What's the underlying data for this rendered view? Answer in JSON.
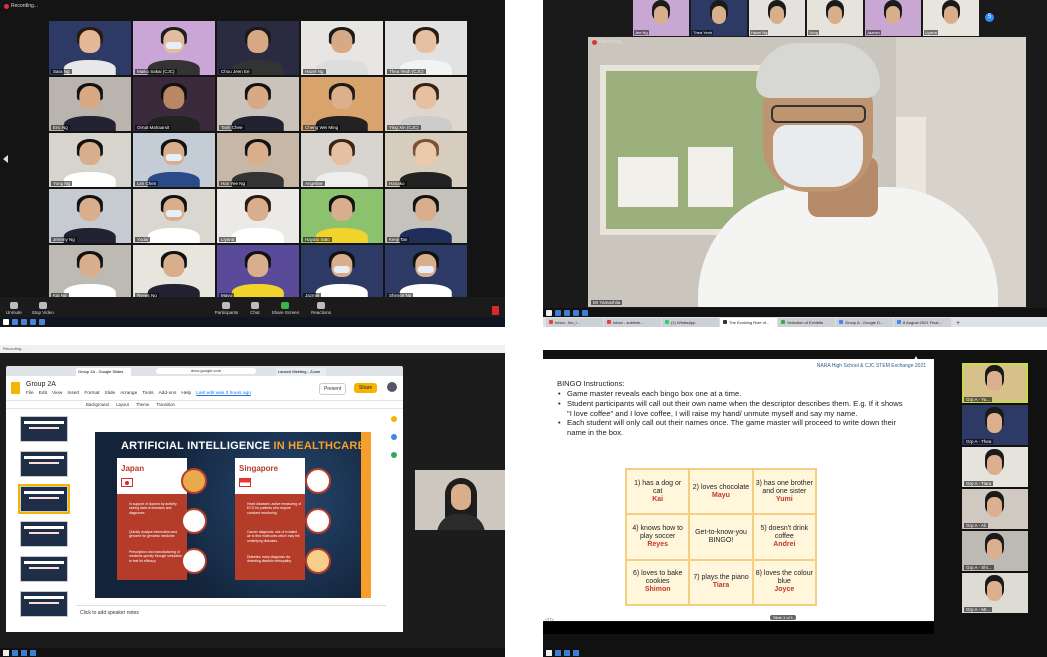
{
  "recording_label": "Recording...",
  "gallery": {
    "tiles": [
      {
        "name": "Sara Ng",
        "bg": "#2d3a66",
        "skin": "#e4b894",
        "hair": "#2a1a12",
        "body": "#e8e8e8",
        "mask": false,
        "speaker": true
      },
      {
        "name": "Maiko Sakai (CJC)",
        "bg": "#c9a6d6",
        "skin": "#e2bc9e",
        "hair": "#1d1d1d",
        "body": "#333",
        "mask": true
      },
      {
        "name": "Chou Jeen Ee",
        "bg": "#2a2a40",
        "skin": "#d8a884",
        "hair": "#1a1a1a",
        "body": "#333",
        "mask": false
      },
      {
        "name": "Hazel Ng",
        "bg": "#e8e6e2",
        "skin": "#d7a985",
        "hair": "#1a1a1a",
        "body": "#ddd",
        "mask": false
      },
      {
        "name": "Thea Yeoh (CJC)",
        "bg": "#e2e2e2",
        "skin": "#e6c0a0",
        "hair": "#2a1a10",
        "body": "#f3f3f3",
        "mask": false
      },
      {
        "name": "Eric Ng",
        "bg": "#b9b4ae",
        "skin": "#d7a985",
        "hair": "#111",
        "body": "#223",
        "mask": false
      },
      {
        "name": "Ornat Mahaarsit",
        "bg": "#3a2a3c",
        "skin": "#b98766",
        "hair": "#111",
        "body": "#222",
        "mask": false
      },
      {
        "name": "Tarik Chee",
        "bg": "#c9c3bb",
        "skin": "#d7a985",
        "hair": "#111",
        "body": "#223",
        "mask": false
      },
      {
        "name": "Cheng Wei Ming",
        "bg": "#d9a36d",
        "skin": "#dcb08a",
        "hair": "#1a1a1a",
        "body": "#222",
        "mask": false
      },
      {
        "name": "Ying Xin (CJC)",
        "bg": "#ddd7cf",
        "skin": "#e6c0a0",
        "hair": "#3a2010",
        "body": "#ccc",
        "mask": false
      },
      {
        "name": "Yong Ng",
        "bg": "#d7d3cd",
        "skin": "#d8ae8c",
        "hair": "#111",
        "body": "#fff",
        "mask": false
      },
      {
        "name": "Lim Chen",
        "bg": "#c4ccd6",
        "skin": "#d8ae8c",
        "hair": "#111",
        "body": "#2b4a8a",
        "mask": true
      },
      {
        "name": "Han Yee Ng",
        "bg": "#c7b7a6",
        "skin": "#d8ae8c",
        "hair": "#111",
        "body": "#333",
        "mask": false
      },
      {
        "name": "Angeline",
        "bg": "#d8d4d0",
        "skin": "#e6c0a0",
        "hair": "#3a2416",
        "body": "#eee",
        "mask": false
      },
      {
        "name": "Hanako",
        "bg": "#d6cdbf",
        "skin": "#ecc9ab",
        "hair": "#7a5132",
        "body": "#222",
        "mask": false
      },
      {
        "name": "Jeremy Ng",
        "bg": "#c6cbd1",
        "skin": "#d8ae8c",
        "hair": "#111",
        "body": "#223",
        "mask": false
      },
      {
        "name": "Yudai",
        "bg": "#dad6d0",
        "skin": "#d8ae8c",
        "hair": "#111",
        "body": "#fff",
        "mask": true
      },
      {
        "name": "Liyana",
        "bg": "#eceae6",
        "skin": "#d8ae8c",
        "hair": "#2a1a10",
        "body": "#fff",
        "mask": false
      },
      {
        "name": "Hayato Sato",
        "bg": "#8cc16d",
        "skin": "#d8ae8c",
        "hair": "#111",
        "body": "#f0d42b",
        "mask": false
      },
      {
        "name": "Kenji Tan",
        "bg": "#c5c1bb",
        "skin": "#d8ae8c",
        "hair": "#111",
        "body": "#1e2d5a",
        "mask": false
      },
      {
        "name": "Kai Ng",
        "bg": "#bdbab4",
        "skin": "#d8ae8c",
        "hair": "#111",
        "body": "#fff",
        "mask": false
      },
      {
        "name": "Reyes Ng",
        "bg": "#e8e4de",
        "skin": "#d8ae8c",
        "hair": "#111",
        "body": "#223",
        "mask": false
      },
      {
        "name": "Mayu",
        "bg": "#5a4a9a",
        "skin": "#d8ae8c",
        "hair": "#111",
        "body": "#f0d42b",
        "mask": false
      },
      {
        "name": "Jazmin",
        "bg": "#2d3a66",
        "skin": "#d8ae8c",
        "hair": "#111",
        "body": "#fff",
        "mask": true
      },
      {
        "name": "Shimon Ng",
        "bg": "#2d3a66",
        "skin": "#d8ae8c",
        "hair": "#111",
        "body": "#fff",
        "mask": true
      }
    ],
    "toolbar": [
      {
        "label": "Unmute"
      },
      {
        "label": "Stop Video"
      },
      {
        "label": "Participants"
      },
      {
        "label": "Chat"
      },
      {
        "label": "Share Screen"
      },
      {
        "label": "Reactions"
      }
    ]
  },
  "speaker_view": {
    "strip": [
      {
        "name": "Jee Ng",
        "bg": "#c8a7d2"
      },
      {
        "name": "Thea Yeoh",
        "bg": "#2d3a66"
      },
      {
        "name": "Hazel Ng",
        "bg": "#e4e2de"
      },
      {
        "name": "Yong",
        "bg": "#e6e2dc"
      },
      {
        "name": "Jazmin",
        "bg": "#c8a7d2"
      },
      {
        "name": "Liyana",
        "bg": "#e8e4de"
      }
    ],
    "participant_count": "5",
    "speaker_name": "Mr Yamashita",
    "browser_tabs": [
      {
        "label": "Inbox - lim_l..."
      },
      {
        "label": "Inbox - sublime..."
      },
      {
        "label": "(1) WhatsApp"
      },
      {
        "label": "The Evolving Role of..."
      },
      {
        "label": "Selection of Exhibits"
      },
      {
        "label": "Group A - Google D..."
      },
      {
        "label": "8 August 2021 Final..."
      }
    ]
  },
  "slides_share": {
    "top_label": "Recording...",
    "url": "docs.google.com",
    "tab_label": "Group 2A - Google Slides",
    "tab2_label": "Launch Meeting - Zoom",
    "doc_title": "Group 2A",
    "menu": [
      "File",
      "Edit",
      "View",
      "Insert",
      "Format",
      "Slide",
      "Arrange",
      "Tools",
      "Add-ons",
      "Help"
    ],
    "last_edit": "Last edit was 3 hours ago",
    "present_label": "Present",
    "share_label": "Share",
    "toolbar": [
      "Background",
      "Layout",
      "Theme",
      "Transition"
    ],
    "thumb_numbers": [
      "1",
      "2",
      "3",
      "4",
      "5",
      "6"
    ],
    "slide": {
      "title_part1": "ARTIFICIAL INTELLIGENCE",
      "title_part2": "IN HEALTHCARE",
      "left_country": "Japan",
      "right_country": "Singapore",
      "left_bullets": [
        "In support of doctors by actively storing data of diseases and diagnoses.",
        "Quickly analyse information and genome for genomic medicine.",
        "Prescription and manufacturing of medicine quickly through simulation to test for efficacy."
      ],
      "right_bullets": [
        "Heart diseases: active measuring of ECG for patients who require constant monitoring.",
        "Cancer diagnosis: use of exhaled air to find molecules which may tell underlying diseases.",
        "Diabetes: early diagnosis via detecting diabetic retinopathy."
      ]
    },
    "notes_placeholder": "Click to add speaker notes"
  },
  "bingo": {
    "header": "NARA High School & CJC STEM Exchange 2021",
    "title": "BINGO Instructions:",
    "instructions": [
      "Game master reveals each bingo box one at a time.",
      "Student participants will call out their own name when the descriptor describes them. E.g. If it shows \"I love coffee\" and I love coffee, I will raise my hand/ unmute myself and say my name.",
      "Each student will only call out their names once. The game master will proceed to write down their name in the box."
    ],
    "cells": [
      {
        "text": "1) has a dog or cat",
        "who": "Kai"
      },
      {
        "text": "2) loves chocolate",
        "who": "Mayu"
      },
      {
        "text": "3) has one brother and one sister",
        "who": "Yumi"
      },
      {
        "text": "4) knows how to play soccer",
        "who": "Reyes"
      },
      {
        "text": "Get-to-know-you BINGO!",
        "who": ""
      },
      {
        "text": "5) doesn't drink coffee",
        "who": "Andrei"
      },
      {
        "text": "6) loves to bake cookies",
        "who": "Shimon"
      },
      {
        "text": "7) plays the piano",
        "who": "Tiara"
      },
      {
        "text": "8) loves the colour blue",
        "who": "Joyce"
      }
    ],
    "slide_nav": "Slide 1 of 1",
    "sidebar": [
      {
        "name": "Grp A - Yu...",
        "bg": "#d6c18a",
        "speaker": true
      },
      {
        "name": "Grp A - Thea",
        "bg": "#2d3a66"
      },
      {
        "name": "Grp A - Tiara",
        "bg": "#e6e2dc"
      },
      {
        "name": "Grp A - Ali",
        "bg": "#cfc9c1"
      },
      {
        "name": "Grp A - Shi...",
        "bg": "#bdbab4"
      },
      {
        "name": "Grp A - Mr...",
        "bg": "#dedad4"
      }
    ]
  }
}
